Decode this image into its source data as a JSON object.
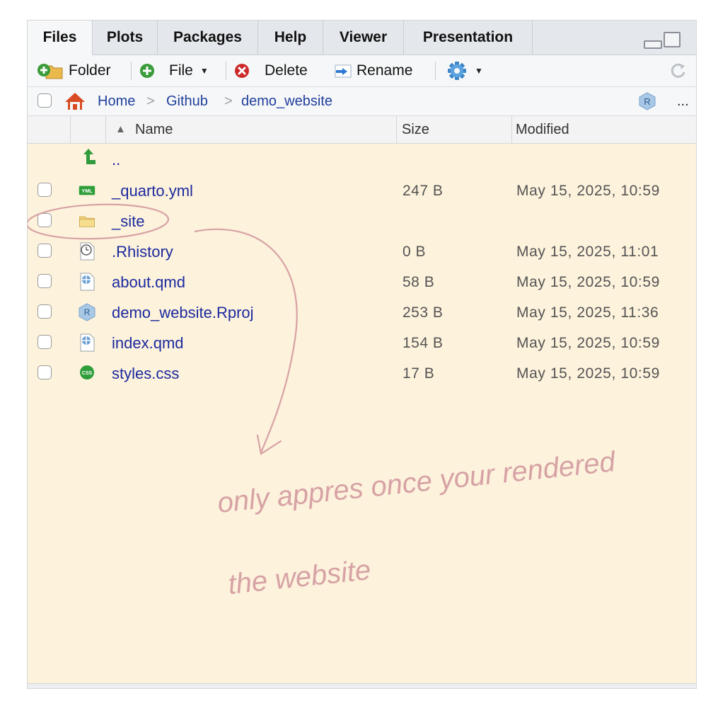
{
  "tabs": [
    {
      "label": "Files",
      "active": true
    },
    {
      "label": "Plots"
    },
    {
      "label": "Packages"
    },
    {
      "label": "Help"
    },
    {
      "label": "Viewer"
    },
    {
      "label": "Presentation"
    }
  ],
  "toolbar": {
    "folder_label": "Folder",
    "file_label": "File",
    "delete_label": "Delete",
    "rename_label": "Rename"
  },
  "breadcrumb": {
    "items": [
      "Home",
      "Github",
      "demo_website"
    ],
    "more_label": "..."
  },
  "columns": {
    "name": "Name",
    "size": "Size",
    "modified": "Modified",
    "sort_indicator": "▲"
  },
  "parent_dir_label": "..",
  "files": [
    {
      "name": "_quarto.yml",
      "size": "247 B",
      "modified": "May 15, 2025, 10:59",
      "icon": "yml-file-icon"
    },
    {
      "name": "_site",
      "size": "",
      "modified": "",
      "icon": "folder-icon"
    },
    {
      "name": ".Rhistory",
      "size": "0 B",
      "modified": "May 15, 2025, 11:01",
      "icon": "history-file-icon"
    },
    {
      "name": "about.qmd",
      "size": "58 B",
      "modified": "May 15, 2025, 10:59",
      "icon": "quarto-file-icon"
    },
    {
      "name": "demo_website.Rproj",
      "size": "253 B",
      "modified": "May 15, 2025, 11:36",
      "icon": "rproj-file-icon"
    },
    {
      "name": "index.qmd",
      "size": "154 B",
      "modified": "May 15, 2025, 10:59",
      "icon": "quarto-file-icon"
    },
    {
      "name": "styles.css",
      "size": "17 B",
      "modified": "May 15, 2025, 10:59",
      "icon": "css-file-icon"
    }
  ],
  "annotation": {
    "line1": "only appres once your rendered",
    "line2": "the website",
    "color": "#d7a2a5"
  },
  "colors": {
    "pane_bg": "#fdf2dc",
    "link": "#1b2a9e"
  }
}
